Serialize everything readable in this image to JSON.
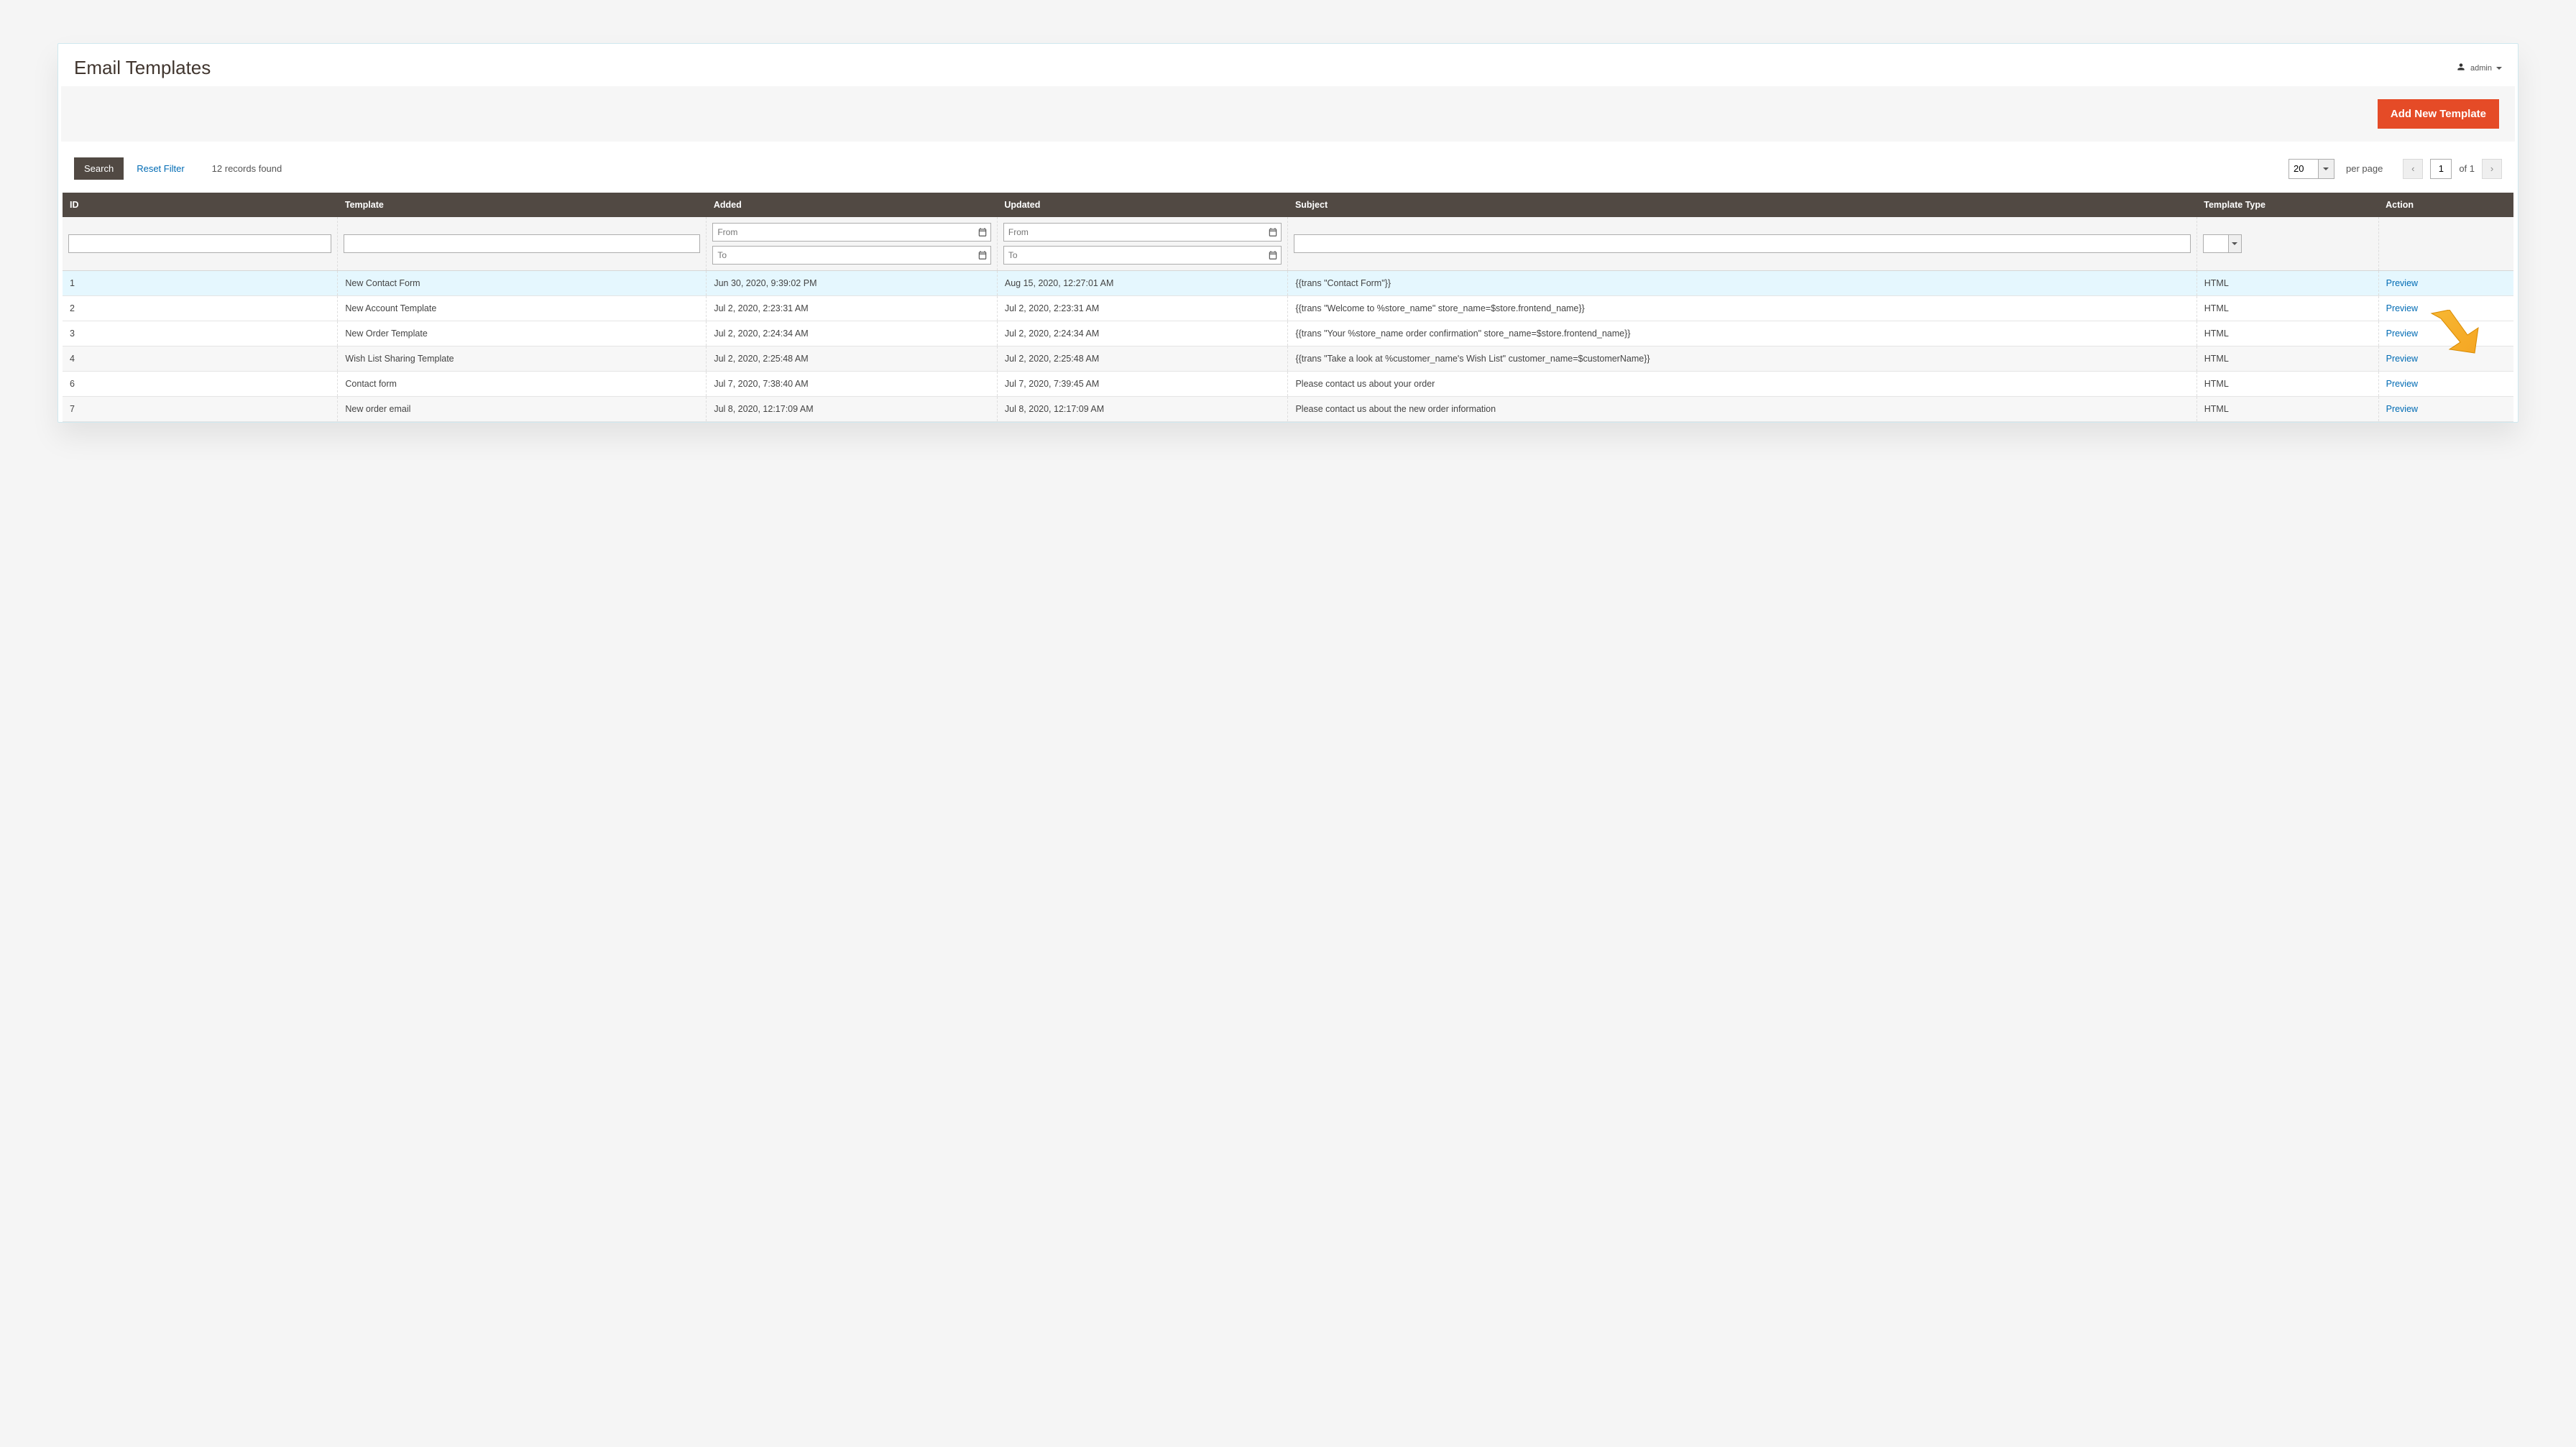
{
  "header": {
    "title": "Email Templates",
    "username": "admin"
  },
  "actions": {
    "add_new": "Add New Template"
  },
  "toolbar": {
    "search": "Search",
    "reset": "Reset Filter",
    "records_found": "12 records found",
    "page_size": "20",
    "per_page": "per page",
    "page_num": "1",
    "of_pages": "of 1"
  },
  "columns": {
    "id": "ID",
    "template": "Template",
    "added": "Added",
    "updated": "Updated",
    "subject": "Subject",
    "type": "Template Type",
    "action": "Action"
  },
  "filters": {
    "from": "From",
    "to": "To"
  },
  "rows": [
    {
      "id": "1",
      "template": "New Contact Form",
      "added": "Jun 30, 2020, 9:39:02 PM",
      "updated": "Aug 15, 2020, 12:27:01 AM",
      "subject": "{{trans \"Contact Form\"}}",
      "type": "HTML",
      "action": "Preview",
      "highlight": true
    },
    {
      "id": "2",
      "template": "New Account Template",
      "added": "Jul 2, 2020, 2:23:31 AM",
      "updated": "Jul 2, 2020, 2:23:31 AM",
      "subject": "{{trans \"Welcome to %store_name\" store_name=$store.frontend_name}}",
      "type": "HTML",
      "action": "Preview"
    },
    {
      "id": "3",
      "template": "New Order Template",
      "added": "Jul 2, 2020, 2:24:34 AM",
      "updated": "Jul 2, 2020, 2:24:34 AM",
      "subject": "{{trans \"Your %store_name order confirmation\" store_name=$store.frontend_name}}",
      "type": "HTML",
      "action": "Preview"
    },
    {
      "id": "4",
      "template": "Wish List Sharing Template",
      "added": "Jul 2, 2020, 2:25:48 AM",
      "updated": "Jul 2, 2020, 2:25:48 AM",
      "subject": "{{trans \"Take a look at %customer_name's Wish List\" customer_name=$customerName}}",
      "type": "HTML",
      "action": "Preview",
      "alt": true
    },
    {
      "id": "6",
      "template": "Contact form",
      "added": "Jul 7, 2020, 7:38:40 AM",
      "updated": "Jul 7, 2020, 7:39:45 AM",
      "subject": "Please contact us about your order",
      "type": "HTML",
      "action": "Preview"
    },
    {
      "id": "7",
      "template": "New order email",
      "added": "Jul 8, 2020, 12:17:09 AM",
      "updated": "Jul 8, 2020, 12:17:09 AM",
      "subject": "Please contact us about the new order information",
      "type": "HTML",
      "action": "Preview",
      "alt": true
    }
  ]
}
